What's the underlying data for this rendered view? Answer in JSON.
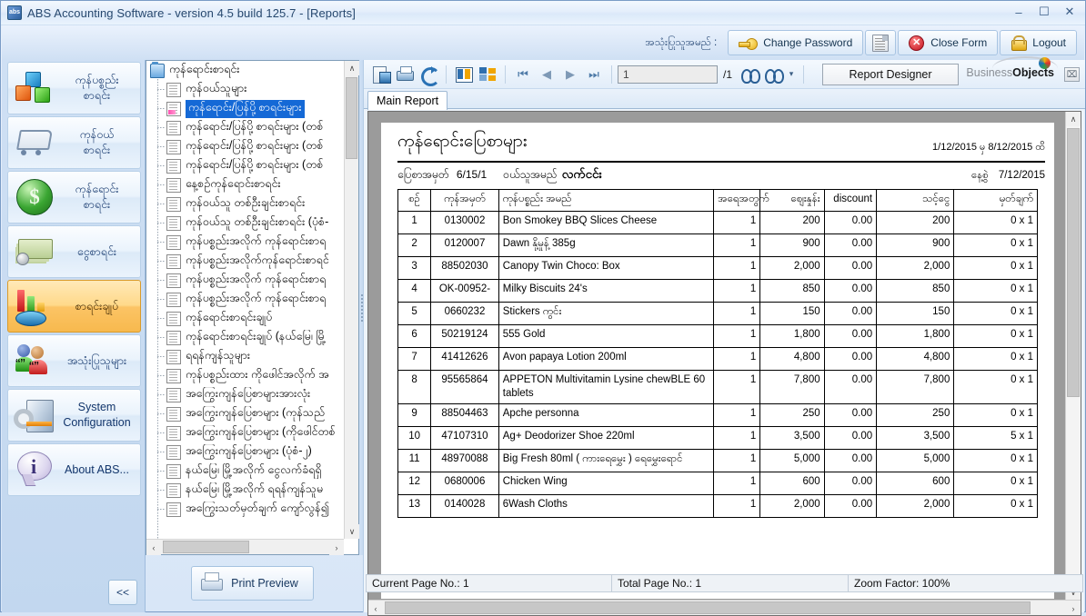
{
  "window": {
    "title": "ABS Accounting Software - version 4.5 build 125.7 - [Reports]",
    "app_icon": "abs",
    "minimize": "–",
    "maximize": "☐",
    "close": "✕"
  },
  "topbar": {
    "user_label": "အသုံးပြုသူအမည် :",
    "change_password": "Change Password",
    "report_icon_btn": "",
    "close_form": "Close Form",
    "logout": "Logout"
  },
  "sidebar": {
    "items": [
      {
        "label_line1": "ကုန်ပစ္စည်း",
        "label_line2": "စာရင်း",
        "icon": "boxes-icon",
        "active": false
      },
      {
        "label_line1": "ကုန်ဝယ်",
        "label_line2": "စာရင်း",
        "icon": "cart-icon",
        "active": false
      },
      {
        "label_line1": "ကုန်ရောင်း",
        "label_line2": "စာရင်း",
        "icon": "dollar-icon",
        "active": false
      },
      {
        "label_line1": "ငွေစာရင်း",
        "label_line2": "",
        "icon": "cash-icon",
        "active": false
      },
      {
        "label_line1": "စာရင်းချုပ်",
        "label_line2": "",
        "icon": "chart-icon",
        "active": true
      },
      {
        "label_line1": "အသုံးပြုသူများ",
        "label_line2": "",
        "icon": "users-icon",
        "active": false
      },
      {
        "label_line1": "System",
        "label_line2": "Configuration",
        "icon": "system-config-icon",
        "active": false
      },
      {
        "label_line1": "About ABS...",
        "label_line2": "",
        "icon": "info-icon",
        "active": false
      }
    ],
    "collapse_label": "<<"
  },
  "tree": {
    "root": "ကုန်ရောင်းစာရင်း",
    "nodes": [
      {
        "label": "ကုန်ဝယ်သူများ",
        "selected": false,
        "icon": "page-icon"
      },
      {
        "label": "ကုန်ရောင်း/ပြန်ပို့ စာရင်းများ",
        "selected": true,
        "icon": "page-pink-icon"
      },
      {
        "label": "ကုန်ရောင်း/ပြန်ပို့ စာရင်းများ (တစ်",
        "selected": false,
        "icon": "page-icon"
      },
      {
        "label": "ကုန်ရောင်း/ပြန်ပို့ စာရင်းများ (တစ်",
        "selected": false,
        "icon": "page-icon"
      },
      {
        "label": "ကုန်ရောင်း/ပြန်ပို့ စာရင်းများ (တစ်",
        "selected": false,
        "icon": "page-icon"
      },
      {
        "label": "နေ့စဉ်ကုန်ရောင်းစာရင်း",
        "selected": false,
        "icon": "page-icon"
      },
      {
        "label": "ကုန်ဝယ်သူ တစ်ဦးချင်းစာရင်း",
        "selected": false,
        "icon": "page-icon"
      },
      {
        "label": "ကုန်ဝယ်သူ တစ်ဦးချင်းစာရင်း (ပုံစံ-",
        "selected": false,
        "icon": "page-icon"
      },
      {
        "label": "ကုန်ပစ္စည်းအလိုက် ကုန်ရောင်းစာရ",
        "selected": false,
        "icon": "page-icon"
      },
      {
        "label": "ကုန်ပစ္စည်းအလိုက်ကုန်ရောင်းစာရင်",
        "selected": false,
        "icon": "page-icon"
      },
      {
        "label": "ကုန်ပစ္စည်းအလိုက် ကုန်ရောင်းစာရ",
        "selected": false,
        "icon": "page-icon"
      },
      {
        "label": "ကုန်ပစ္စည်းအလိုက် ကုန်ရောင်းစာရ",
        "selected": false,
        "icon": "page-icon"
      },
      {
        "label": "ကုန်ရောင်းစာရင်းချုပ်",
        "selected": false,
        "icon": "page-icon"
      },
      {
        "label": "ကုန်ရောင်းစာရင်းချုပ် (နယ်မြေ၊ မြို့",
        "selected": false,
        "icon": "page-icon"
      },
      {
        "label": "ရရန်ကျန်သူများ",
        "selected": false,
        "icon": "page-icon"
      },
      {
        "label": "ကုန်ပစ္စည်းထား ကိုဖေါင်အလိုက် အ",
        "selected": false,
        "icon": "page-icon"
      },
      {
        "label": "အကြွေးကျန်ပြေစာများအားလုံး",
        "selected": false,
        "icon": "page-icon"
      },
      {
        "label": "အကြွေးကျန်ပြေစာများ (ကုန်သည်",
        "selected": false,
        "icon": "page-icon"
      },
      {
        "label": "အကြွေးကျန်ပြေစာများ (ကိုဖေါင်တစ်",
        "selected": false,
        "icon": "page-icon"
      },
      {
        "label": "အကြွေးကျန်ပြေစာများ (ပုံစံ-၂)",
        "selected": false,
        "icon": "page-icon"
      },
      {
        "label": "နယ်မြေ၊ မြို့အလိုက် ငွေလက်ခံရရှိ",
        "selected": false,
        "icon": "page-icon"
      },
      {
        "label": "နယ်မြေ၊ မြို့အလိုက် ရရန်ကျန်သူမ",
        "selected": false,
        "icon": "page-icon"
      },
      {
        "label": "အကြွေးသတ်မှတ်ချက် ကျော်လွန်၍",
        "selected": false,
        "icon": "page-icon"
      }
    ],
    "scroll_left_arrow": "‹",
    "scroll_right_arrow": "›",
    "scroll_up_arrow": "∧",
    "scroll_down_arrow": "∨"
  },
  "print_preview": {
    "label": "Print Preview"
  },
  "report_toolbar": {
    "export_icon": "export-icon",
    "print_icon": "print-icon",
    "refresh_icon": "refresh-icon",
    "grid_icon": "grid-view-icon",
    "tree_icon": "group-tree-icon",
    "first_page": "⏮",
    "prev_page": "◀",
    "next_page": "▶",
    "last_page": "⏭",
    "page_number": "1",
    "page_total": "/1",
    "find_icon": "find-icon",
    "find_next_icon": "find-next-icon",
    "dropdown_caret": "▾",
    "report_designer": "Report Designer",
    "brand_light": "Business",
    "brand_bold": "Objects",
    "bo_close": "⌧"
  },
  "tabs": {
    "main_report": "Main Report"
  },
  "report": {
    "title": "ကုန်ရောင်းပြေစာများ",
    "date_range": "1/12/2015 မှ  8/12/2015 ထိ",
    "voucher_label": "ပြေစာအမှတ်",
    "voucher_no": "6/15/1",
    "buyer_label": "ဝယ်သူအမည်",
    "buyer_name": "လက်ငင်း",
    "date_label": "နေ့စွဲ",
    "date_value": "7/12/2015",
    "columns": [
      "စဉ်",
      "ကုန်အမှတ်",
      "ကုန်ပစ္စည်း အမည်",
      "အရေအတွက်",
      "ဈေးနှုန်း",
      "discount",
      "သင့်ငွေ",
      "မှတ်ချက်"
    ],
    "rows": [
      {
        "no": "1",
        "code": "0130002",
        "name": "Bon Smokey BBQ Slices Cheese",
        "qty": "1",
        "price": "200",
        "discount": "0.00",
        "total": "200",
        "note": "0 x 1"
      },
      {
        "no": "2",
        "code": "0120007",
        "name": "Dawn နို့မှုန့် 385g",
        "qty": "1",
        "price": "900",
        "discount": "0.00",
        "total": "900",
        "note": "0 x 1"
      },
      {
        "no": "3",
        "code": "88502030",
        "name": "Canopy Twin Choco: Box",
        "qty": "1",
        "price": "2,000",
        "discount": "0.00",
        "total": "2,000",
        "note": "0 x 1"
      },
      {
        "no": "4",
        "code": "OK-00952-",
        "name": "Milky  Biscuits 24's",
        "qty": "1",
        "price": "850",
        "discount": "0.00",
        "total": "850",
        "note": "0 x 1"
      },
      {
        "no": "5",
        "code": "0660232",
        "name": "Stickers ကွင်း",
        "qty": "1",
        "price": "150",
        "discount": "0.00",
        "total": "150",
        "note": "0 x 1"
      },
      {
        "no": "6",
        "code": "50219124",
        "name": "555 Gold",
        "qty": "1",
        "price": "1,800",
        "discount": "0.00",
        "total": "1,800",
        "note": "0 x 1"
      },
      {
        "no": "7",
        "code": "41412626",
        "name": "Avon papaya  Lotion  200ml",
        "qty": "1",
        "price": "4,800",
        "discount": "0.00",
        "total": "4,800",
        "note": "0 x 1"
      },
      {
        "no": "8",
        "code": "95565864",
        "name": "APPETON Multivitamin Lysine chewBLE 60 tablets",
        "qty": "1",
        "price": "7,800",
        "discount": "0.00",
        "total": "7,800",
        "note": "0 x 1"
      },
      {
        "no": "9",
        "code": "88504463",
        "name": "Apche personna",
        "qty": "1",
        "price": "250",
        "discount": "0.00",
        "total": "250",
        "note": "0 x 1"
      },
      {
        "no": "10",
        "code": "47107310",
        "name": "Ag+ Deodorizer Shoe 220ml",
        "qty": "1",
        "price": "3,500",
        "discount": "0.00",
        "total": "3,500",
        "note": "5 x 1"
      },
      {
        "no": "11",
        "code": "48970088",
        "name": "Big Fresh 80ml ( ကားရေမွှေး ) ရေမွှေးရောင်",
        "qty": "1",
        "price": "5,000",
        "discount": "0.00",
        "total": "5,000",
        "note": "0 x 1"
      },
      {
        "no": "12",
        "code": "0680006",
        "name": "Chicken Wing",
        "qty": "1",
        "price": "600",
        "discount": "0.00",
        "total": "600",
        "note": "0 x 1"
      },
      {
        "no": "13",
        "code": "0140028",
        "name": "6Wash Cloths",
        "qty": "1",
        "price": "2,000",
        "discount": "0.00",
        "total": "2,000",
        "note": "0 x 1"
      }
    ]
  },
  "statusbar": {
    "current_page": "Current Page No.: 1",
    "total_page": "Total Page No.: 1",
    "zoom_factor": "Zoom Factor: 100%"
  }
}
